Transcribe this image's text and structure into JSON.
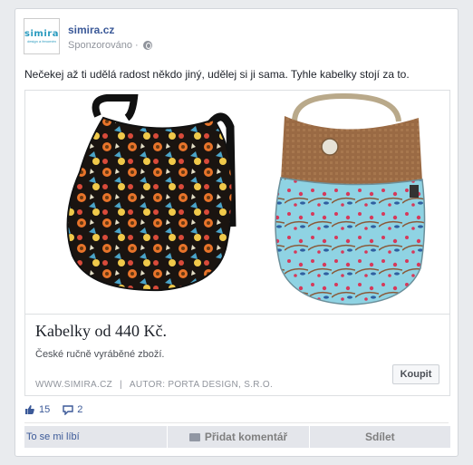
{
  "header": {
    "avatar_text": "simira",
    "avatar_subtext": "design a fenomén",
    "page_name": "simira.cz",
    "sponsored_label": "Sponzorováno",
    "dot": "·"
  },
  "post": {
    "text": "Nečekej až ti udělá radost někdo jiný, udělej si ji sama. Tyhle kabelky stojí za to."
  },
  "ad": {
    "headline": "Kabelky od 440 Kč.",
    "description": "České ručně vyráběné zboží.",
    "domain": "WWW.SIMIRA.CZ",
    "separator": "|",
    "author": "AUTOR: PORTA DESIGN, S.R.O.",
    "cta_label": "Koupit"
  },
  "stats": {
    "likes": "15",
    "comments": "2"
  },
  "actions": {
    "like_label": "To se mi líbí",
    "comment_label": "Přidat komentář",
    "share_label": "Sdílet"
  },
  "colors": {
    "link": "#3b5998",
    "brand": "#2a9bbf"
  },
  "icons": [
    "globe-icon",
    "like-thumb-icon",
    "comment-bubble-icon"
  ]
}
